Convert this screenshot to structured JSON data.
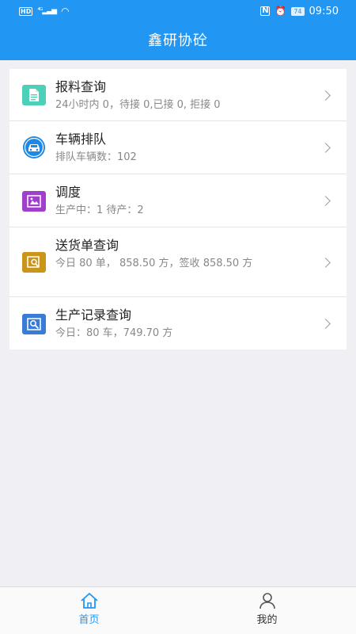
{
  "status_bar": {
    "hd": "HD",
    "signal": "4G",
    "nfc": "N",
    "battery": "74",
    "time": "09:50"
  },
  "header": {
    "title": "鑫研协砼"
  },
  "menu": {
    "items": [
      {
        "title": "报料查询",
        "subtitle": "24小时内 0，待接 0,已接 0, 拒接 0",
        "icon": "document-icon",
        "color": "#4dd0b8"
      },
      {
        "title": "车辆排队",
        "subtitle": "排队车辆数：102",
        "icon": "car-icon",
        "color": "#1e88e5"
      },
      {
        "title": "调度",
        "subtitle": "生产中：1 待产：2",
        "icon": "dispatch-icon",
        "color": "#a03fcc"
      },
      {
        "title": "送货单查询",
        "subtitle": "今日 80 单， 858.50 方，签收 858.50 方",
        "icon": "receipt-search-icon",
        "color": "#c9961a"
      },
      {
        "title": "生产记录查询",
        "subtitle": "今日：80 车，749.70 方",
        "icon": "record-search-icon",
        "color": "#3a7bd5"
      }
    ]
  },
  "tabbar": {
    "home_label": "首页",
    "mine_label": "我的",
    "active_color": "#2196f3"
  }
}
